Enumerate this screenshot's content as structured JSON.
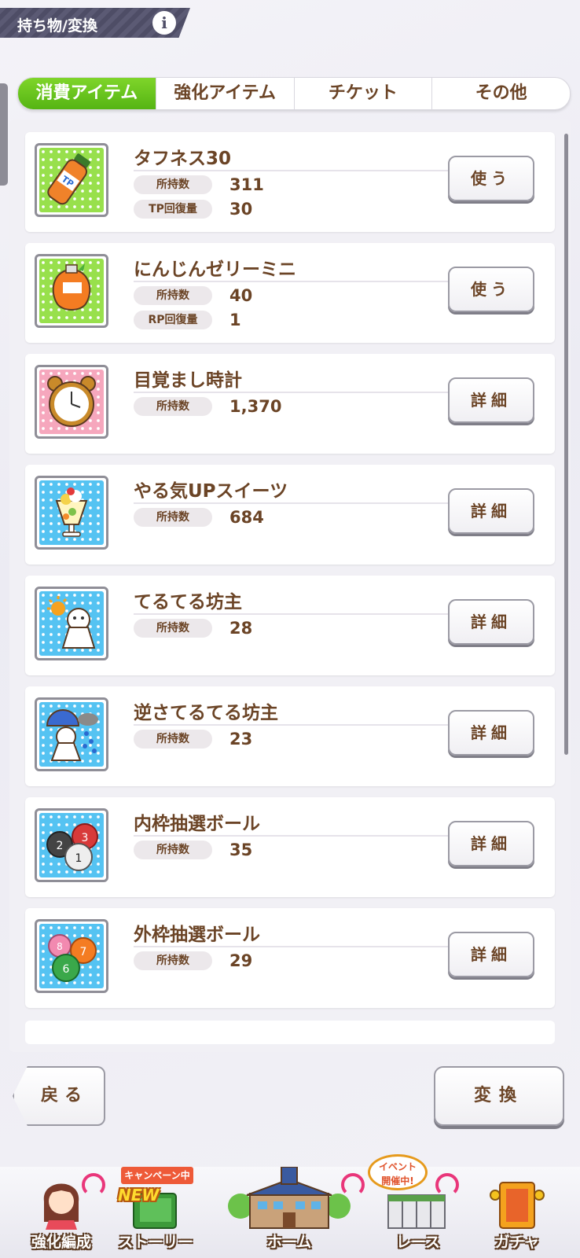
{
  "header": {
    "title": "持ち物/変換",
    "info_label": "i"
  },
  "tabs": [
    "消費アイテム",
    "強化アイテム",
    "チケット",
    "その他"
  ],
  "stat_label_owned": "所持数",
  "items": [
    {
      "name": "タフネス30",
      "owned": "311",
      "extra_label": "TP回復量",
      "extra_value": "30",
      "action": "使う",
      "icon": "tp-bottle-icon",
      "bg": "#98e04c"
    },
    {
      "name": "にんじんゼリーミニ",
      "owned": "40",
      "extra_label": "RP回復量",
      "extra_value": "1",
      "action": "使う",
      "icon": "carrot-jelly-icon",
      "bg": "#98e04c"
    },
    {
      "name": "目覚まし時計",
      "owned": "1,370",
      "action": "詳細",
      "icon": "alarm-clock-icon",
      "bg": "#f6a7bd"
    },
    {
      "name": "やる気UPスイーツ",
      "owned": "684",
      "action": "詳細",
      "icon": "parfait-icon",
      "bg": "#55c3f2"
    },
    {
      "name": "てるてる坊主",
      "owned": "28",
      "action": "詳細",
      "icon": "teru-teru-bozu-icon",
      "bg": "#55c3f2"
    },
    {
      "name": "逆さてるてる坊主",
      "owned": "23",
      "action": "詳細",
      "icon": "upside-down-teru-teru-bozu-icon",
      "bg": "#55c3f2"
    },
    {
      "name": "内枠抽選ボール",
      "owned": "35",
      "action": "詳細",
      "icon": "inner-draw-balls-icon",
      "bg": "#55c3f2"
    },
    {
      "name": "外枠抽選ボール",
      "owned": "29",
      "action": "詳細",
      "icon": "outer-draw-balls-icon",
      "bg": "#55c3f2"
    }
  ],
  "buttons": {
    "back": "戻る",
    "exchange": "変換"
  },
  "nav": {
    "items": [
      "強化編成",
      "ストーリー",
      "ホーム",
      "レース",
      "ガチャ"
    ],
    "campaign_badge": "キャンペーン中",
    "new_badge": "NEW",
    "event_badge_line1": "イベント",
    "event_badge_line2": "開催中!"
  },
  "colors": {
    "active_tab": "#55b413",
    "text": "#6b4426",
    "header": "#4e4d66"
  }
}
